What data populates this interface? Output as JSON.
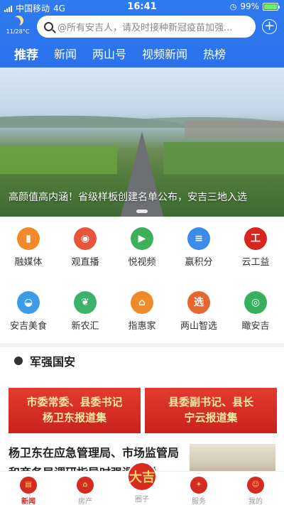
{
  "status": {
    "carrier": "中国移动",
    "network": "4G",
    "time": "16:41",
    "battery": "99%",
    "battery_level": 0.99
  },
  "weather": {
    "text": "11/28°C",
    "icon": "moon-icon"
  },
  "search": {
    "placeholder": "@所有安吉人，请及时接种新冠疫苗加强..."
  },
  "tabs": [
    "推荐",
    "新闻",
    "两山号",
    "视频新闻",
    "热榜"
  ],
  "banner": {
    "caption": "高颜值高内涵！省级样板创建名单公布，安吉三地入选"
  },
  "grid": [
    {
      "label": "融媒体",
      "icon": "signal-chart-icon",
      "color": "#f08a2c",
      "glyph": "▮"
    },
    {
      "label": "观直播",
      "icon": "live-eye-icon",
      "color": "#e8553a",
      "glyph": "◉"
    },
    {
      "label": "悦视频",
      "icon": "video-film-icon",
      "color": "#3fb05a",
      "glyph": "▶"
    },
    {
      "label": "赢积分",
      "icon": "coin-stack-icon",
      "color": "#3c8be8",
      "glyph": "≡"
    },
    {
      "label": "云工益",
      "icon": "gongyi-icon",
      "color": "#d8251d",
      "glyph": "工"
    },
    {
      "label": "安吉美食",
      "icon": "food-cloche-icon",
      "color": "#3c9ce8",
      "glyph": "◒"
    },
    {
      "label": "新农汇",
      "icon": "farm-leaf-icon",
      "color": "#3bb16a",
      "glyph": "❦"
    },
    {
      "label": "指惠家",
      "icon": "home-discount-icon",
      "color": "#ef8a2a",
      "glyph": "⌂"
    },
    {
      "label": "两山智选",
      "icon": "liangshan-select-icon",
      "color": "#e5672f",
      "glyph": "选"
    },
    {
      "label": "瞰安吉",
      "icon": "view-target-icon",
      "color": "#36b05e",
      "glyph": "◎"
    }
  ],
  "section": {
    "title": "军强国安"
  },
  "cards": [
    {
      "line1": "市委常委、县委书记",
      "line2": "杨卫东报道集"
    },
    {
      "line1": "县委副书记、县长",
      "line2": "宁云报道集"
    }
  ],
  "news": {
    "title": "杨卫东在应急管理局、市场监管局和商务局调研指导时强调：树"
  },
  "bottom_nav": [
    {
      "label": "新闻",
      "icon": "news-icon",
      "active": true
    },
    {
      "label": "房产",
      "icon": "house-icon"
    },
    {
      "label": "圈子",
      "icon": "daji-circle-icon",
      "center_text": "大吉"
    },
    {
      "label": "服务",
      "icon": "service-icon"
    },
    {
      "label": "我的",
      "icon": "profile-icon"
    }
  ]
}
